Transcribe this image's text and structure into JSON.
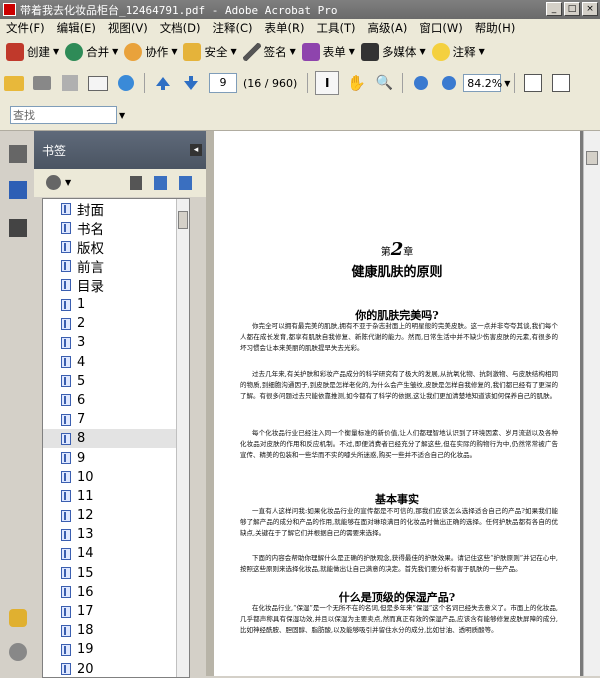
{
  "window": {
    "title": "带着我去化妆品柜台_12464791.pdf - Adobe Acrobat Pro"
  },
  "menu": [
    "文件(F)",
    "编辑(E)",
    "视图(V)",
    "文档(D)",
    "注释(C)",
    "表单(R)",
    "工具(T)",
    "高级(A)",
    "窗口(W)",
    "帮助(H)"
  ],
  "toolbar1": {
    "create": "创建",
    "combine": "合并",
    "collaborate": "协作",
    "security": "安全",
    "sign": "签名",
    "forms": "表单",
    "multimedia": "多媒体",
    "comment": "注释"
  },
  "nav": {
    "page": "9",
    "count": "(16 / 960)",
    "zoom": "84.2%"
  },
  "find": {
    "placeholder": "查找"
  },
  "panel": {
    "title": "书签"
  },
  "bookmarks": [
    "封面",
    "书名",
    "版权",
    "前言",
    "目录",
    "1",
    "2",
    "3",
    "4",
    "5",
    "6",
    "7",
    "8",
    "9",
    "10",
    "11",
    "12",
    "13",
    "14",
    "15",
    "16",
    "17",
    "18",
    "19",
    "20"
  ],
  "selected_bookmark": "8",
  "page": {
    "chapter_prefix": "第",
    "chapter_num": "2",
    "chapter_suffix": "章",
    "chapter_title": "健康肌肤的原则",
    "h_a": "你的肌肤完美吗?",
    "p1": "你完全可以拥有最完美的肌肤,拥有不亚于杂志封面上的明星般的完美皮肤。这一点并非夸夸其谈,我们每个人都在成长发育,都享有肌肤自我修复、新陈代谢的能力。然而,日常生活中并不缺少伤害皮肤的元素,有很多的坏习惯会让本来美丽的肌肤提早失去光彩。",
    "p2": "过去几年来,有关护肤和彩妆产品成分的科学研究有了极大的发展,从抗氧化物、抗刺激物、与皮肤结构相同的物质,到细胞沟通因子,到皮肤是怎样老化的,为什么会产生皱纹,皮肤是怎样自我修复的,我们都已经有了更深的了解。有很多问题过去只能依靠推测,如今都有了科学的依据,这让我们更加清楚地知道该如何保养自己的肌肤。",
    "p3": "每个化妆品行业已经注入同一个衡量标准的新价值,让人们都理智地认识到了环境因素、岁月流逝以及各种化妆品对皮肤的作用和反应机制。不过,即便消费者已经充分了解这些,但在实际的购物行为中,仍然常常被广告宣传、精美的包装和一些华而不实的噱头所迷惑,购买一些并不适合自己的化妆品。",
    "h_b": "基本事实",
    "p4": "一直有人这样问我:如果化妆品行业的宣传都是不可信的,那我们应该怎么选择适合自己的产品?如果我们能够了解产品的成分和产品的作用,就能够在面对琳琅满目的化妆品时做出正确的选择。任何护肤品都有各自的优缺点,关键在于了解它们并根据自己的需要来选择。",
    "p5": "下面的内容会帮助你理解什么是正确的护肤观念,获得最佳的护肤效果。请记住这些“护肤原则”并记在心中,按照这些原则来选择化妆品,就能做出让自己满意的决定。首先我们要分析有害于肌肤的一些产品。",
    "h_c": "什么是顶级的保湿产品?",
    "p6": "在化妆品行业,“保湿”是一个无所不在的名词,但是多年来“保湿”这个名词已经失去意义了。市面上的化妆品,几乎都声称具有保湿功效,并且以保湿为主要卖点,然而真正有效的保湿产品,应该含有能够修复皮肤屏障的成分,比如神经酰胺、胆固醇、脂肪酸,以及能够吸引并留住水分的成分,比如甘油、透明质酸等。"
  }
}
